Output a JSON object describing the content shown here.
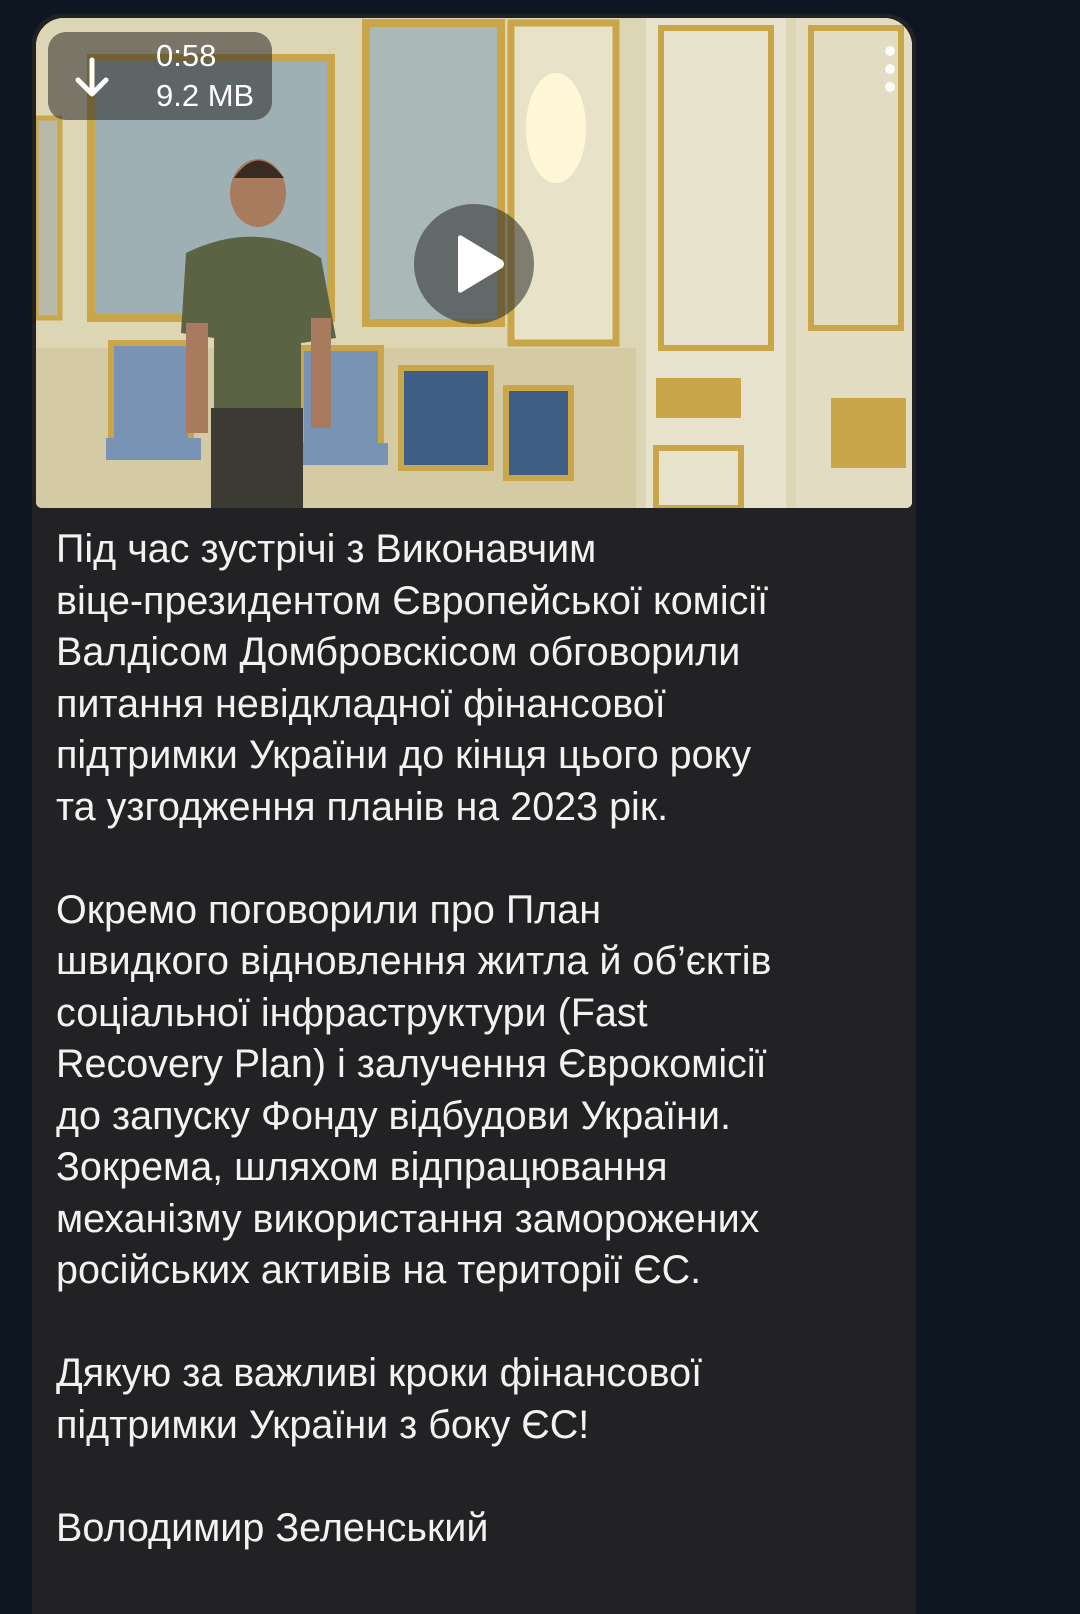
{
  "video": {
    "duration": "0:58",
    "file_size": "9.2 MB",
    "download_icon": "arrow-down-icon",
    "menu_icon": "more-vertical-icon",
    "play_icon": "play-icon"
  },
  "message": {
    "paragraph1": [
      "Під час зустрічі з Виконавчим",
      "віце-президентом Європейської комісії",
      "Валдісом Домбровскісом обговорили",
      "питання невідкладної фінансової",
      "підтримки України до кінця цього року",
      "та узгодження планів на 2023 рік."
    ],
    "paragraph2": [
      "Окремо поговорили про План",
      "швидкого відновлення житла й об’єктів",
      "соціальної інфраструктури (Fast",
      "Recovery Plan) і залучення Єврокомісії",
      "до запуску Фонду відбудови України.",
      "Зокрема, шляхом відпрацювання",
      "механізму використання заморожених",
      "російських активів на території ЄС."
    ],
    "paragraph3": [
      "Дякую за важливі кроки фінансової",
      "підтримки України з боку ЄС!"
    ],
    "signature": "Володимир Зеленський"
  },
  "colors": {
    "background": "#0e1621",
    "bubble": "#222224",
    "text": "#f2f2f2"
  }
}
